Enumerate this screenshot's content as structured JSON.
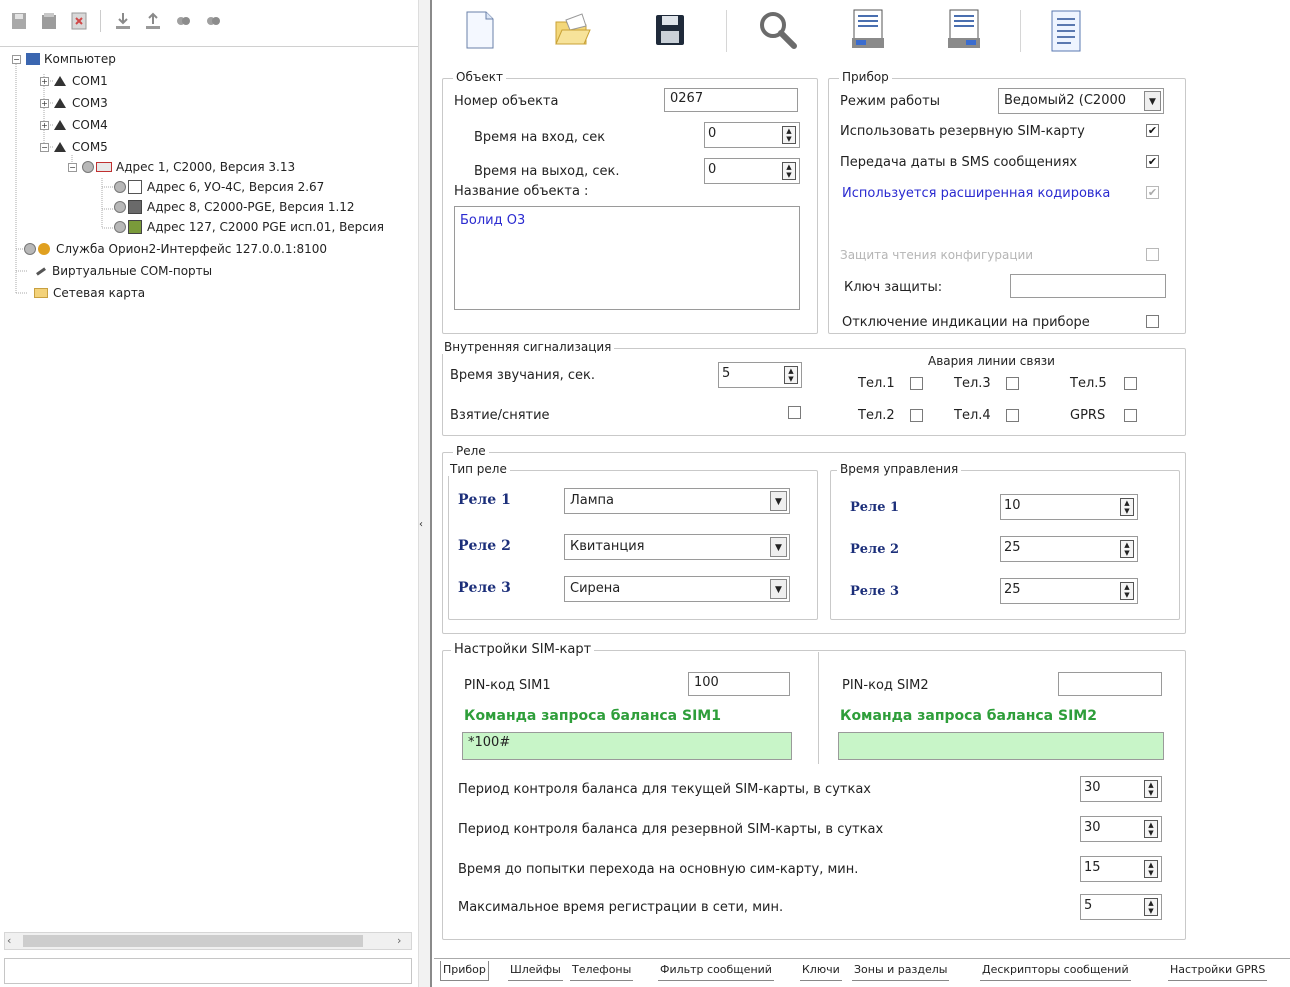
{
  "toolbar_left": {
    "icons": [
      "save-icon",
      "disk-icon",
      "delete-icon",
      "download-icon",
      "upload-icon",
      "device-icon",
      "device-add-icon"
    ]
  },
  "toolbar_right": {
    "icons": [
      "new-document-icon",
      "open-folder-icon",
      "save-icon",
      "search-icon",
      "device-read-icon",
      "device-write-icon",
      "report-icon"
    ]
  },
  "tree": {
    "root": "Компьютер",
    "items": [
      "COM1",
      "COM3",
      "COM4",
      "COM5"
    ],
    "devices": [
      "Адрес 1, С2000, Версия 3.13",
      "Адрес 6, УО-4С, Версия 2.67",
      "Адрес 8, С2000-PGE, Версия 1.12",
      "Адрес 127, С2000 PGE исп.01, Версия"
    ],
    "service": "Служба Орион2-Интерфейс 127.0.0.1:8100",
    "virtual": "Виртуальные COM-порты",
    "network": "Сетевая карта"
  },
  "object": {
    "legend": "Объект",
    "number_label": "Номер объекта",
    "number_value": "0267",
    "entry_label": "Время на вход, сек",
    "entry_value": "0",
    "exit_label": "Время на выход, сек.",
    "exit_value": "0",
    "name_label": "Название объекта :",
    "name_value": "Болид О3"
  },
  "device": {
    "legend": "Прибор",
    "mode_label": "Режим работы",
    "mode_value": "Ведомый2 (С2000",
    "reserve_sim_label": "Использовать резервную SIM-карту",
    "reserve_sim_checked": "✔",
    "sms_date_label": "Передача даты в SMS сообщениях",
    "sms_date_checked": "✔",
    "ext_encoding_label": "Используется расширенная кодировка",
    "ext_encoding_checked": "✔",
    "read_protect_label": "Защита чтения конфигурации",
    "key_label": "Ключ защиты:",
    "key_value": "",
    "indication_off_label": "Отключение индикации на приборе"
  },
  "alarm": {
    "legend": "Внутренняя сигнализация",
    "sound_label": "Время звучания, сек.",
    "sound_value": "5",
    "arm_label": "Взятие/снятие",
    "line_fail_title": "Авария линии связи",
    "tel1": "Тел.1",
    "tel2": "Тел.2",
    "tel3": "Тел.3",
    "tel4": "Тел.4",
    "tel5": "Тел.5",
    "gprs": "GPRS"
  },
  "relay": {
    "legend": "Реле",
    "type_legend": "Тип реле",
    "time_legend": "Время управления",
    "r1": "Реле 1",
    "r2": "Реле 2",
    "r3": "Реле 3",
    "r1_type": "Лампа",
    "r2_type": "Квитанция",
    "r3_type": "Сирена",
    "r1_time": "10",
    "r2_time": "25",
    "r3_time": "25"
  },
  "sim": {
    "legend": "Настройки SIM-карт",
    "pin1_label": "PIN-код SIM1",
    "pin1_value": "100",
    "pin2_label": "PIN-код SIM2",
    "pin2_value": "",
    "balance1_label": "Команда запроса баланса SIM1",
    "balance1_value": "*100#",
    "balance2_label": "Команда запроса баланса SIM2",
    "balance2_value": "",
    "period_current_label": "Период контроля баланса для текущей SIM-карты, в сутках",
    "period_current_value": "30",
    "period_reserve_label": "Период контроля баланса для резервной SIM-карты, в сутках",
    "period_reserve_value": "30",
    "switch_time_label": "Время до попытки перехода на основную сим-карту, мин.",
    "switch_time_value": "15",
    "reg_time_label": "Максимальное время регистрации в сети, мин.",
    "reg_time_value": "5"
  },
  "tabs": [
    "Прибор",
    "Шлейфы",
    "Телефоны",
    "Фильтр сообщений",
    "Ключи",
    "Зоны и разделы",
    "Дескрипторы сообщений",
    "Настройки GPRS"
  ],
  "colors": {
    "accent_green": "#c8f5c8",
    "legend_teal": "#1e8fa3",
    "label_navy": "#1c2f7a",
    "link_blue": "#2a2ad0"
  }
}
